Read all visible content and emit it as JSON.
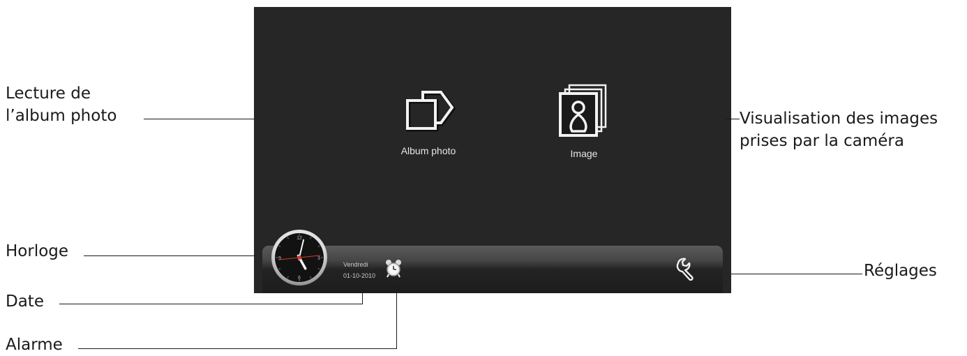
{
  "screen": {
    "apps": [
      {
        "label": "Album photo",
        "icon": "album-photo-icon"
      },
      {
        "label": "Image",
        "icon": "camera-images-icon"
      }
    ],
    "status_bar": {
      "day": "Vendredi",
      "date": "01-10-2010",
      "clock": {
        "hours": 5,
        "minutes": 2,
        "seconds": 14
      },
      "clock_numerals": [
        "12",
        "3",
        "6",
        "9"
      ],
      "alarm_icon": "alarm-clock-icon",
      "settings_icon": "wrench-icon"
    }
  },
  "annotations": {
    "album_line1": "Lecture de",
    "album_line2": "l’album photo",
    "image_line1": "Visualisation des images",
    "image_line2": "prises par la caméra",
    "clock": "Horloge",
    "date": "Date",
    "alarm": "Alarme",
    "settings": "Réglages"
  },
  "colors": {
    "screen_bg": "#262626",
    "clock_red": "#d23a2a",
    "text_light": "#e6e6e6"
  }
}
